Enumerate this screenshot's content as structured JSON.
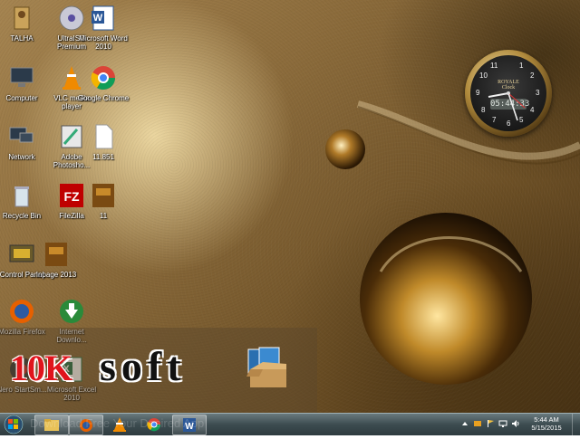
{
  "desktop": {
    "icons": [
      {
        "label": "TALHA",
        "icon": "user-folder-icon"
      },
      {
        "label": "UltraISO Premium",
        "icon": "ultraiso-disc-icon"
      },
      {
        "label": "Microsoft Word 2010",
        "icon": "word-icon"
      },
      {
        "label": "Computer",
        "icon": "computer-icon"
      },
      {
        "label": "VLC media player",
        "icon": "vlc-cone-icon"
      },
      {
        "label": "Google Chrome",
        "icon": "chrome-icon"
      },
      {
        "label": "Network",
        "icon": "network-icon"
      },
      {
        "label": "Adobe Photosho...",
        "icon": "photoshop-icon"
      },
      {
        "label": "11.851",
        "icon": "blank-file-icon"
      },
      {
        "label": "Recycle Bin",
        "icon": "recycle-bin-icon"
      },
      {
        "label": "FileZilla",
        "icon": "filezilla-icon"
      },
      {
        "label": "11",
        "icon": "inpage-file-icon"
      },
      {
        "label": "Control Panel",
        "icon": "control-panel-icon"
      },
      {
        "label": "Inpage 2013",
        "icon": "inpage-icon"
      },
      {
        "label": "Mozilla Firefox",
        "icon": "firefox-icon"
      },
      {
        "label": "Internet Downlo...",
        "icon": "idm-icon"
      },
      {
        "label": "Nero StartSm...",
        "icon": "nero-icon"
      },
      {
        "label": "Microsoft Excel 2010",
        "icon": "excel-icon"
      }
    ]
  },
  "clock_gadget": {
    "brand": "ROYALE",
    "sub": "Clock",
    "digital_time": "05:44:33",
    "numerals": [
      "1",
      "2",
      "3",
      "4",
      "5",
      "6",
      "7",
      "8",
      "9",
      "10",
      "11"
    ]
  },
  "watermark": {
    "prefix": "10K",
    "suffix": "soft",
    "underlay_text": "Download Free Your Desired App"
  },
  "taskbar": {
    "items": [
      {
        "name": "start-button",
        "icon": "windows-orb-icon"
      },
      {
        "name": "taskbar-explorer",
        "icon": "folder-icon"
      },
      {
        "name": "taskbar-firefox",
        "icon": "firefox-icon"
      },
      {
        "name": "taskbar-vlc",
        "icon": "vlc-cone-icon"
      },
      {
        "name": "taskbar-chrome",
        "icon": "chrome-icon"
      },
      {
        "name": "taskbar-word",
        "icon": "word-icon"
      }
    ],
    "tray": {
      "time": "5:44 AM",
      "date": "5/15/2015"
    }
  },
  "colors": {
    "taskbar": "#3d4c50",
    "watermark_red": "#e0141c",
    "wallpaper_gold": "#8c6c3c"
  }
}
